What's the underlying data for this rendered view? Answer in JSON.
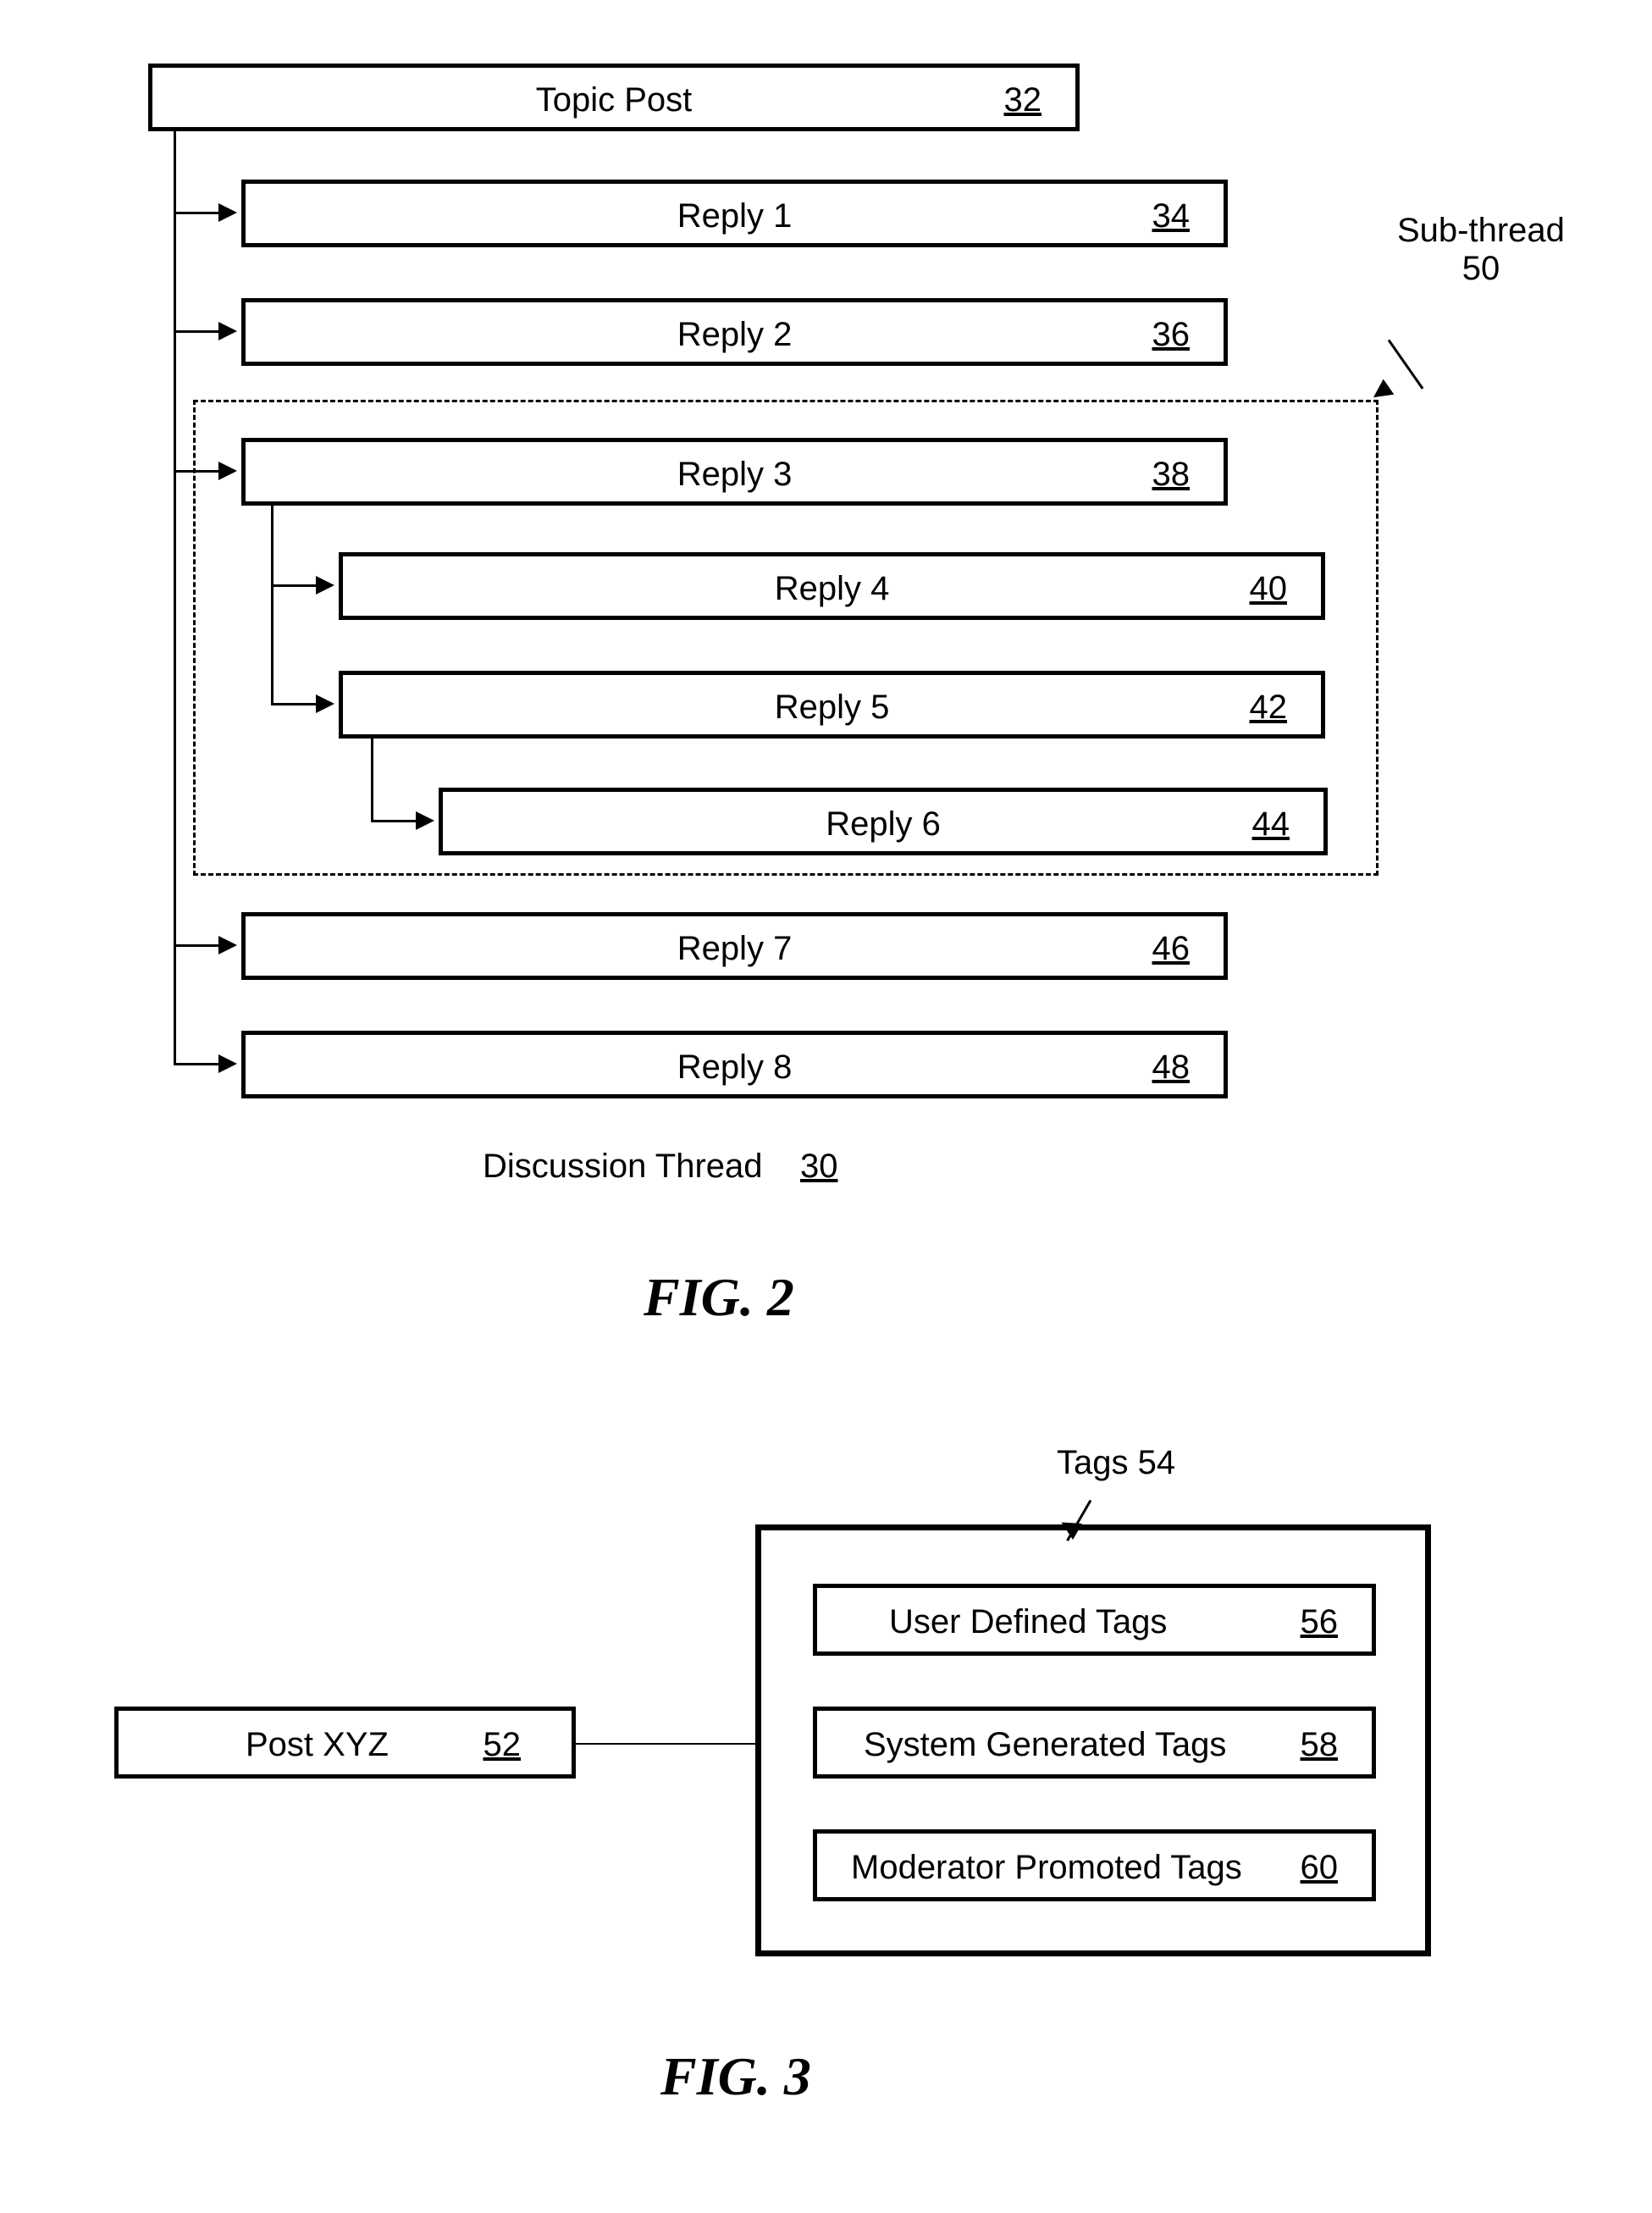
{
  "fig2": {
    "subthread_label": "Sub-thread",
    "subthread_ref": "50",
    "nodes": {
      "topic": {
        "label": "Topic Post",
        "ref": "32"
      },
      "reply1": {
        "label": "Reply 1",
        "ref": "34"
      },
      "reply2": {
        "label": "Reply 2",
        "ref": "36"
      },
      "reply3": {
        "label": "Reply 3",
        "ref": "38"
      },
      "reply4": {
        "label": "Reply 4",
        "ref": "40"
      },
      "reply5": {
        "label": "Reply 5",
        "ref": "42"
      },
      "reply6": {
        "label": "Reply 6",
        "ref": "44"
      },
      "reply7": {
        "label": "Reply 7",
        "ref": "46"
      },
      "reply8": {
        "label": "Reply 8",
        "ref": "48"
      }
    },
    "caption_label": "Discussion Thread",
    "caption_ref": "30",
    "title": "FIG. 2"
  },
  "fig3": {
    "post": {
      "label": "Post XYZ",
      "ref": "52"
    },
    "tags_label": "Tags 54",
    "tags": {
      "user": {
        "label": "User Defined Tags",
        "ref": "56"
      },
      "sys": {
        "label": "System Generated Tags",
        "ref": "58"
      },
      "mod": {
        "label": "Moderator Promoted Tags",
        "ref": "60"
      }
    },
    "title": "FIG. 3"
  }
}
